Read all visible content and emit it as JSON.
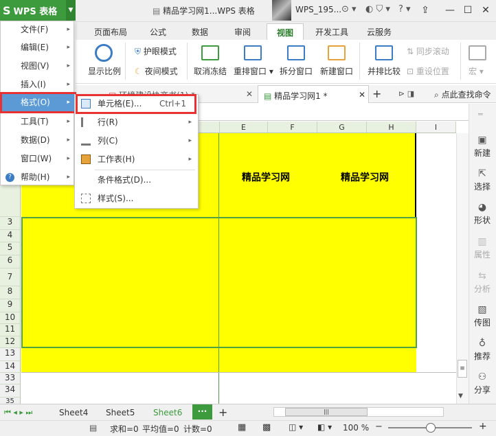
{
  "app": {
    "name": "WPS 表格",
    "doc_title": "精品学习网1...WPS 表格",
    "user": "WPS_195..."
  },
  "ribbon_tabs": [
    "页面布局",
    "公式",
    "数据",
    "审阅",
    "视图",
    "开发工具",
    "云服务"
  ],
  "active_tab": "视图",
  "ribbon": {
    "zoom": "显示比例",
    "eye": "护眼模式",
    "night": "夜间模式",
    "unfreeze": "取消冻结",
    "rearrange": "重排窗口",
    "split": "拆分窗口",
    "new_window": "新建窗口",
    "compare": "并排比较",
    "sync_scroll": "同步滚动",
    "reset_pos": "重设位置",
    "macro": "宏"
  },
  "doc_tabs": {
    "tab1": "环境建设协商书(1) *",
    "tab2": "精品学习网1 *",
    "search": "点此查找命令"
  },
  "columns": [
    "E",
    "F",
    "G",
    "H",
    "I"
  ],
  "rows": [
    "3",
    "4",
    "5",
    "6",
    "7",
    "8",
    "9",
    "10",
    "11",
    "12",
    "13",
    "14",
    "33",
    "34",
    "35"
  ],
  "cells": {
    "f_text": "精品学习网",
    "h_text": "精品学习网"
  },
  "main_menu": [
    {
      "label": "文件(F)"
    },
    {
      "label": "编辑(E)"
    },
    {
      "label": "视图(V)"
    },
    {
      "label": "插入(I)"
    },
    {
      "label": "格式(O)"
    },
    {
      "label": "工具(T)"
    },
    {
      "label": "数据(D)"
    },
    {
      "label": "窗口(W)"
    },
    {
      "label": "帮助(H)"
    }
  ],
  "format_submenu": {
    "cell": "单元格(E)...",
    "cell_shortcut": "Ctrl+1",
    "row": "行(R)",
    "column": "列(C)",
    "worksheet": "工作表(H)",
    "conditional": "条件格式(D)...",
    "style": "样式(S)..."
  },
  "right_panel": [
    "新建",
    "选择",
    "形状",
    "属性",
    "分析",
    "传图",
    "推荐",
    "分享"
  ],
  "sheets": [
    "Sheet4",
    "Sheet5",
    "Sheet6"
  ],
  "active_sheet": "Sheet6",
  "status": {
    "sum": "求和=0",
    "avg": "平均值=0",
    "count": "计数=0",
    "zoom": "100 %"
  },
  "colors": {
    "accent": "#3d9a3d",
    "highlight": "#e83232",
    "cell_fill": "#ffff00"
  }
}
